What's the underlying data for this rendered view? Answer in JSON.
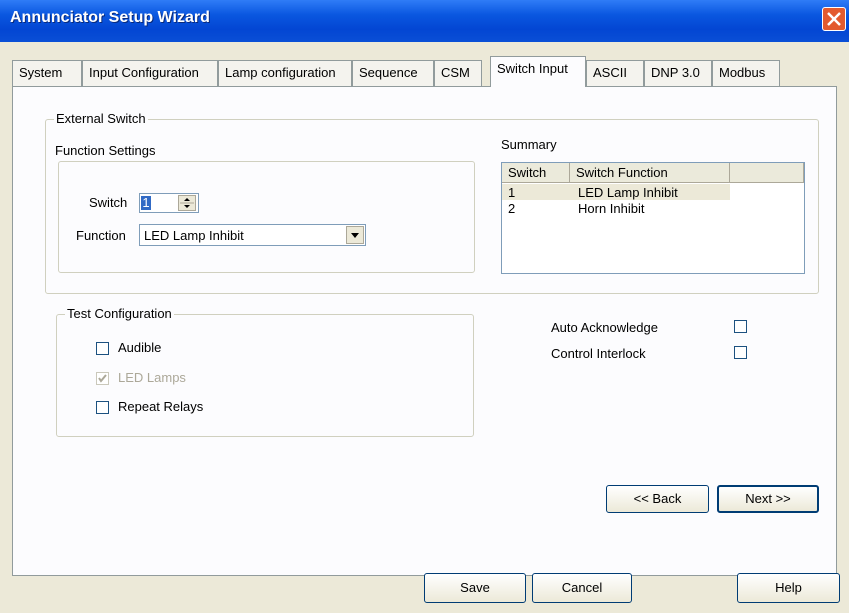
{
  "window": {
    "title": "Annunciator Setup Wizard"
  },
  "tabs": [
    {
      "label": "System"
    },
    {
      "label": "Input Configuration"
    },
    {
      "label": "Lamp configuration"
    },
    {
      "label": "Sequence"
    },
    {
      "label": "CSM"
    },
    {
      "label": "Switch Input"
    },
    {
      "label": "ASCII"
    },
    {
      "label": "DNP 3.0"
    },
    {
      "label": "Modbus"
    }
  ],
  "external_switch": {
    "group_label": "External Switch",
    "function_settings_label": "Function Settings",
    "switch_label": "Switch",
    "switch_value": "1",
    "function_label": "Function",
    "function_value": "LED Lamp Inhibit"
  },
  "summary": {
    "label": "Summary",
    "columns": [
      "Switch",
      "Switch Function"
    ],
    "rows": [
      {
        "switch": "1",
        "function": "LED Lamp Inhibit"
      },
      {
        "switch": "2",
        "function": "Horn Inhibit"
      }
    ]
  },
  "test_configuration": {
    "group_label": "Test Configuration",
    "audible": {
      "label": "Audible",
      "checked": false
    },
    "led_lamps": {
      "label": "LED Lamps",
      "checked": true,
      "disabled": true
    },
    "repeat_relays": {
      "label": "Repeat Relays",
      "checked": false
    }
  },
  "options": {
    "auto_acknowledge": {
      "label": "Auto Acknowledge",
      "checked": false
    },
    "control_interlock": {
      "label": "Control Interlock",
      "checked": false
    }
  },
  "nav": {
    "back_label": "<< Back",
    "next_label": "Next >>"
  },
  "footer": {
    "save_label": "Save",
    "cancel_label": "Cancel",
    "help_label": "Help"
  }
}
